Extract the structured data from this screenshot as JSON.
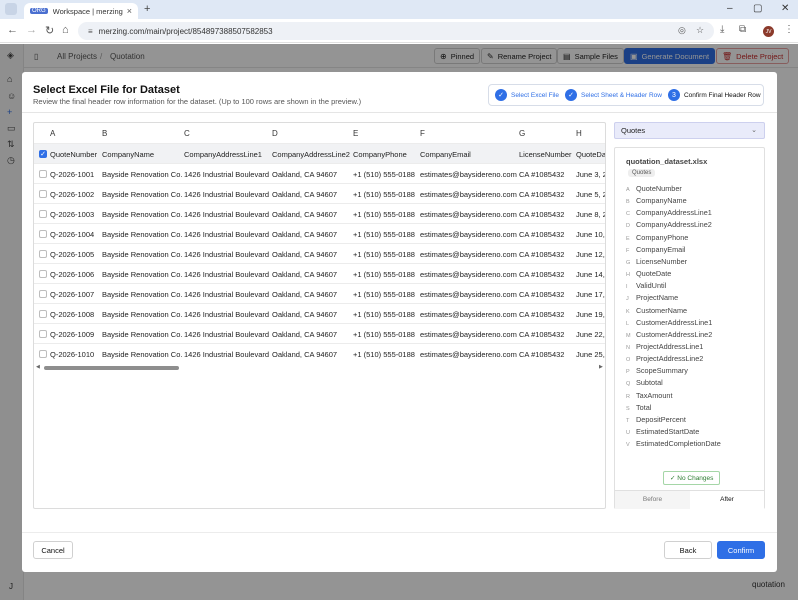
{
  "browser": {
    "tab_title": "Workspace | merzing",
    "tab_favicon": "ORG",
    "url": "merzing.com/main/project/854897388507582853",
    "profile_initials": "JV"
  },
  "app": {
    "breadcrumb": [
      "All Projects",
      "Quotation"
    ],
    "buttons": {
      "pinned": "Pinned",
      "rename": "Rename Project",
      "sample": "Sample Files",
      "generate": "Generate Document",
      "delete": "Delete Project"
    },
    "bg_text": "quotation",
    "user_initial": "J"
  },
  "modal": {
    "title": "Select Excel File for Dataset",
    "subtitle": "Review the final header row information for the dataset. (Up to 100 rows are shown in the preview.)",
    "steps": [
      {
        "label": "Select Excel File",
        "state": "done"
      },
      {
        "label": "Select Sheet & Header Row",
        "state": "done"
      },
      {
        "label": "Confirm Final Header Row",
        "state": "current",
        "number": "3"
      }
    ],
    "grid": {
      "column_letters": [
        "A",
        "B",
        "C",
        "D",
        "E",
        "F",
        "G",
        "H"
      ],
      "header_row": [
        "QuoteNumber",
        "CompanyName",
        "CompanyAddressLine1",
        "CompanyAddressLine2",
        "CompanyPhone",
        "CompanyEmail",
        "LicenseNumber",
        "QuoteDate"
      ],
      "rows": [
        [
          "Q-2026-1001",
          "Bayside Renovation Co.",
          "1426 Industrial Boulevard",
          "Oakland, CA 94607",
          "+1 (510) 555-0188",
          "estimates@baysidereno.com",
          "CA #1085432",
          "June 3, 2"
        ],
        [
          "Q-2026-1002",
          "Bayside Renovation Co.",
          "1426 Industrial Boulevard",
          "Oakland, CA 94607",
          "+1 (510) 555-0188",
          "estimates@baysidereno.com",
          "CA #1085432",
          "June 5, 2"
        ],
        [
          "Q-2026-1003",
          "Bayside Renovation Co.",
          "1426 Industrial Boulevard",
          "Oakland, CA 94607",
          "+1 (510) 555-0188",
          "estimates@baysidereno.com",
          "CA #1085432",
          "June 8, 2"
        ],
        [
          "Q-2026-1004",
          "Bayside Renovation Co.",
          "1426 Industrial Boulevard",
          "Oakland, CA 94607",
          "+1 (510) 555-0188",
          "estimates@baysidereno.com",
          "CA #1085432",
          "June 10, "
        ],
        [
          "Q-2026-1005",
          "Bayside Renovation Co.",
          "1426 Industrial Boulevard",
          "Oakland, CA 94607",
          "+1 (510) 555-0188",
          "estimates@baysidereno.com",
          "CA #1085432",
          "June 12, "
        ],
        [
          "Q-2026-1006",
          "Bayside Renovation Co.",
          "1426 Industrial Boulevard",
          "Oakland, CA 94607",
          "+1 (510) 555-0188",
          "estimates@baysidereno.com",
          "CA #1085432",
          "June 14, "
        ],
        [
          "Q-2026-1007",
          "Bayside Renovation Co.",
          "1426 Industrial Boulevard",
          "Oakland, CA 94607",
          "+1 (510) 555-0188",
          "estimates@baysidereno.com",
          "CA #1085432",
          "June 17, 2"
        ],
        [
          "Q-2026-1008",
          "Bayside Renovation Co.",
          "1426 Industrial Boulevard",
          "Oakland, CA 94607",
          "+1 (510) 555-0188",
          "estimates@baysidereno.com",
          "CA #1085432",
          "June 19, "
        ],
        [
          "Q-2026-1009",
          "Bayside Renovation Co.",
          "1426 Industrial Boulevard",
          "Oakland, CA 94607",
          "+1 (510) 555-0188",
          "estimates@baysidereno.com",
          "CA #1085432",
          "June 22, "
        ],
        [
          "Q-2026-1010",
          "Bayside Renovation Co.",
          "1426 Industrial Boulevard",
          "Oakland, CA 94607",
          "+1 (510) 555-0188",
          "estimates@baysidereno.com",
          "CA #1085432",
          "June 25, "
        ]
      ]
    },
    "sheet_select": "Quotes",
    "panel": {
      "file_name": "quotation_dataset.xlsx",
      "sheet_tag": "Quotes",
      "fields": [
        {
          "k": "A",
          "name": "QuoteNumber"
        },
        {
          "k": "B",
          "name": "CompanyName"
        },
        {
          "k": "C",
          "name": "CompanyAddressLine1"
        },
        {
          "k": "D",
          "name": "CompanyAddressLine2"
        },
        {
          "k": "E",
          "name": "CompanyPhone"
        },
        {
          "k": "F",
          "name": "CompanyEmail"
        },
        {
          "k": "G",
          "name": "LicenseNumber"
        },
        {
          "k": "H",
          "name": "QuoteDate"
        },
        {
          "k": "I",
          "name": "ValidUntil"
        },
        {
          "k": "J",
          "name": "ProjectName"
        },
        {
          "k": "K",
          "name": "CustomerName"
        },
        {
          "k": "L",
          "name": "CustomerAddressLine1"
        },
        {
          "k": "M",
          "name": "CustomerAddressLine2"
        },
        {
          "k": "N",
          "name": "ProjectAddressLine1"
        },
        {
          "k": "O",
          "name": "ProjectAddressLine2"
        },
        {
          "k": "P",
          "name": "ScopeSummary"
        },
        {
          "k": "Q",
          "name": "Subtotal"
        },
        {
          "k": "R",
          "name": "TaxAmount"
        },
        {
          "k": "S",
          "name": "Total"
        },
        {
          "k": "T",
          "name": "DepositPercent"
        },
        {
          "k": "U",
          "name": "EstimatedStartDate"
        },
        {
          "k": "V",
          "name": "EstimatedCompletionDate"
        }
      ],
      "no_changes": "No Changes",
      "before": "Before",
      "after": "After"
    },
    "footer": {
      "cancel": "Cancel",
      "back": "Back",
      "confirm": "Confirm"
    }
  },
  "colors": {
    "accent": "#2f6fe6",
    "danger": "#c62828",
    "success": "#2e7d32"
  }
}
